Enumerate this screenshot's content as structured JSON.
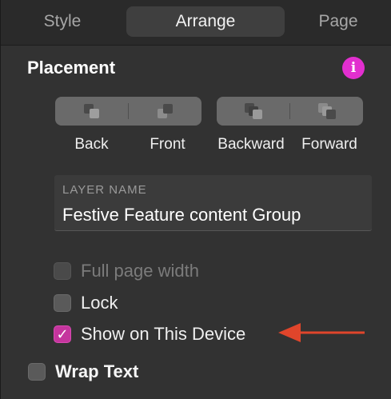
{
  "tabs": [
    {
      "label": "Style",
      "active": false
    },
    {
      "label": "Arrange",
      "active": true
    },
    {
      "label": "Page",
      "active": false
    }
  ],
  "placement": {
    "title": "Placement",
    "info_icon": "info-icon",
    "buttons": [
      {
        "label": "Back",
        "icon": "send-to-back-icon"
      },
      {
        "label": "Front",
        "icon": "bring-to-front-icon"
      },
      {
        "label": "Backward",
        "icon": "send-backward-icon"
      },
      {
        "label": "Forward",
        "icon": "bring-forward-icon"
      }
    ],
    "layer_name": {
      "label": "LAYER NAME",
      "value": "Festive Feature content Group"
    },
    "checkboxes": [
      {
        "label": "Full page width",
        "checked": false,
        "disabled": true
      },
      {
        "label": "Lock",
        "checked": false,
        "disabled": false
      },
      {
        "label": "Show on This Device",
        "checked": true,
        "disabled": false
      },
      {
        "label": "Wrap Text",
        "checked": false,
        "disabled": false
      }
    ]
  },
  "colors": {
    "accent": "#c5359e",
    "info": "#e22fcf",
    "annotation_arrow": "#e0452b"
  }
}
